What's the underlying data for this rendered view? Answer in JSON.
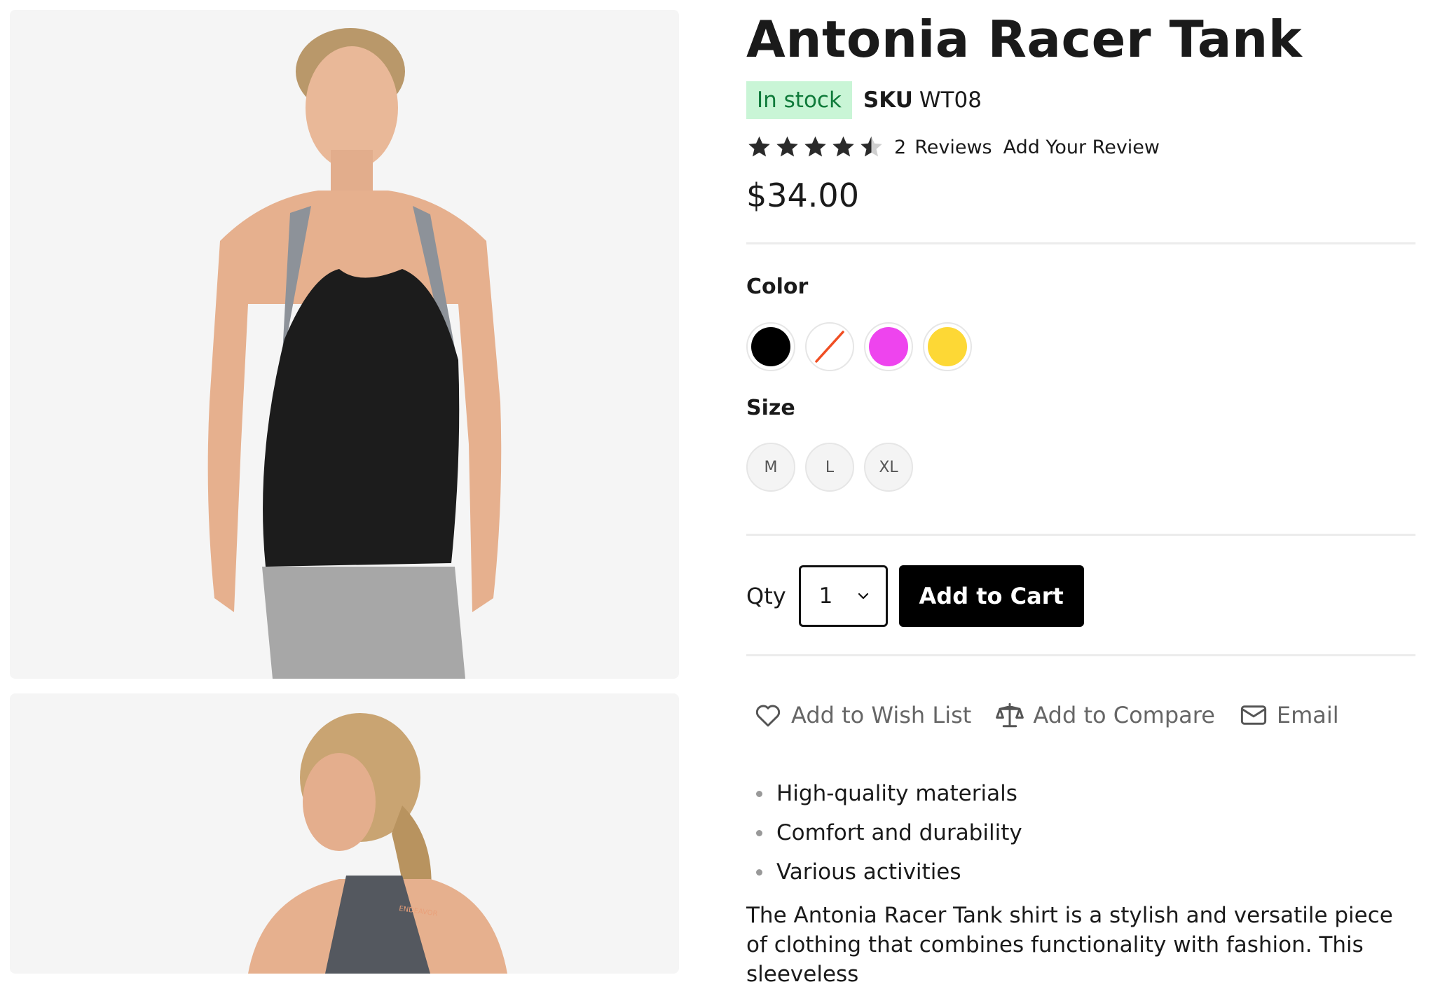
{
  "product": {
    "title": "Antonia Racer Tank",
    "stock_status": "In stock",
    "sku_label": "SKU",
    "sku_value": "WT08",
    "rating": 4.5,
    "rating_max": 5,
    "review_count": "2",
    "reviews_label": "Reviews",
    "add_review_label": "Add Your Review",
    "price": "$34.00"
  },
  "options": {
    "color_label": "Color",
    "colors": [
      {
        "name": "black",
        "hex": "#000000"
      },
      {
        "name": "unavailable",
        "hex": "#ffffff"
      },
      {
        "name": "purple",
        "hex": "#ee44ee"
      },
      {
        "name": "yellow",
        "hex": "#fdd835"
      }
    ],
    "size_label": "Size",
    "sizes": [
      "M",
      "L",
      "XL"
    ]
  },
  "cart": {
    "qty_label": "Qty",
    "qty_value": "1",
    "add_to_cart_label": "Add to Cart"
  },
  "actions": {
    "wishlist_label": "Add to Wish List",
    "compare_label": "Add to Compare",
    "email_label": "Email"
  },
  "features": [
    "High-quality materials",
    "Comfort and durability",
    "Various activities"
  ],
  "description": "The Antonia Racer Tank shirt is a stylish and versatile piece of clothing that combines functionality with fashion. This sleeveless",
  "images": {
    "front_logo_text": "",
    "back_logo_text": "ENDEAVOR"
  },
  "colors": {
    "stock_bg": "#c9f5d6",
    "stock_text": "#0f7a3a",
    "button_bg": "#000000",
    "slash_red": "#f04e23"
  }
}
